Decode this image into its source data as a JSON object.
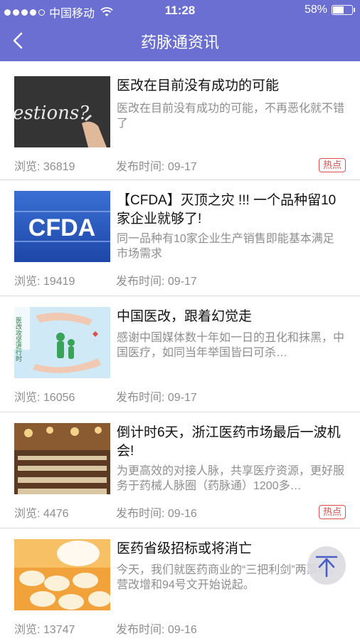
{
  "status_bar": {
    "carrier": "中国移动",
    "time": "11:28",
    "battery": "58%",
    "battery_level": 0.58,
    "signal_dots_filled": 4,
    "signal_dots_total": 5
  },
  "navbar": {
    "title": "药脉通资讯",
    "back_icon": "chevron-left-icon"
  },
  "articles": [
    {
      "title": "医改在目前没有成功的可能",
      "summary": "医改在目前没有成功的可能，不再恶化就不错了",
      "views": "浏览: 36819",
      "date": "发布时间: 09-17",
      "hot": "热点"
    },
    {
      "title": "【CFDA】灭顶之灾 !!! 一个品种留10家企业就够了!",
      "summary": "同一品种有10家企业生产销售即能基本满足市场需求",
      "views": "浏览: 19419",
      "date": "发布时间: 09-17",
      "hot": ""
    },
    {
      "title": "中国医改，跟着幻觉走",
      "summary": "感谢中国媒体数十年如一日的丑化和抹黑，中国医疗，如同当年举国皆曰可杀…",
      "views": "浏览: 16056",
      "date": "发布时间: 09-17",
      "hot": ""
    },
    {
      "title": "倒计时6天，浙江医药市场最后一波机会!",
      "summary": "为更高效的对接人脉，共享医疗资源，更好服务于药械人脉圈（药脉通）1200多…",
      "views": "浏览: 4476",
      "date": "发布时间: 09-16",
      "hot": "热点"
    },
    {
      "title": "医药省级招标或将消亡",
      "summary": "今天，我们就医药商业的“三把利剑”两票制、营改增和94号文开始说起。",
      "views": "浏览: 13747",
      "date": "发布时间: 09-16",
      "hot": ""
    }
  ],
  "thumbnails": {
    "a1_text": "estions?",
    "a2_text": "CFDA",
    "a3_text": "医改攻坚进行时"
  },
  "colors": {
    "header": "#6a6fd1",
    "hot": "#e24c4c",
    "secondary_text": "#8e8e8e"
  },
  "scroll_top_icon": "back-to-top-icon"
}
